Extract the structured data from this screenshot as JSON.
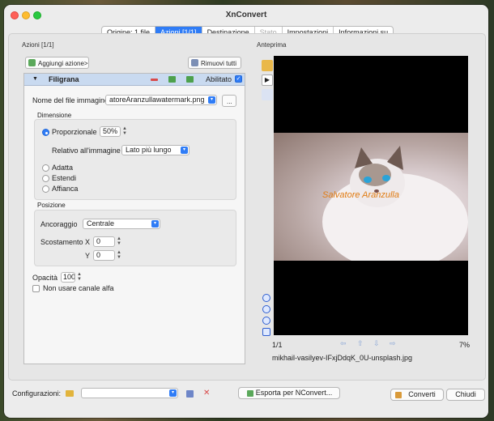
{
  "window": {
    "title": "XnConvert"
  },
  "tabs": [
    {
      "label": "Origine: 1 file",
      "state": "normal"
    },
    {
      "label": "Azioni [1/1]",
      "state": "active"
    },
    {
      "label": "Destinazione",
      "state": "normal"
    },
    {
      "label": "Stato",
      "state": "disabled"
    },
    {
      "label": "Impostazioni",
      "state": "normal"
    },
    {
      "label": "Informazioni su",
      "state": "normal"
    }
  ],
  "actions": {
    "header": "Azioni [1/1]",
    "add_button": "Aggiungi azione>",
    "remove_all_button": "Rimuovi tutti",
    "item": {
      "name": "Filigrana",
      "enabled_label": "Abilitato",
      "enabled": true,
      "file_label": "Nome del file immagine",
      "file_value": "atoreAranzullawatermark.png",
      "browse_label": "...",
      "dimension": {
        "title": "Dimensione",
        "proportional_label": "Proporzionale",
        "proportional_value": "50%",
        "relative_label": "Relativo all'immagine",
        "relative_value": "Lato più lungo",
        "fit_label": "Adatta",
        "stretch_label": "Estendi",
        "tile_label": "Affianca"
      },
      "position": {
        "title": "Posizione",
        "anchor_label": "Ancoraggio",
        "anchor_value": "Centrale",
        "offset_label": "Scostamento",
        "x_label": "X",
        "x_value": "0",
        "y_label": "Y",
        "y_value": "0"
      },
      "opacity_label": "Opacità",
      "opacity_value": "100",
      "no_alpha_label": "Non usare canale alfa",
      "no_alpha_checked": false
    }
  },
  "preview": {
    "header": "Anteprima",
    "watermark_text": "Salvatore Aranzulla",
    "counter": "1/1",
    "zoom": "7%",
    "filename": "mikhail-vasilyev-IFxjDdqK_0U-unsplash.jpg"
  },
  "bottom": {
    "config_label": "Configurazioni:",
    "config_value": "",
    "export_button": "Esporta per NConvert...",
    "convert_button": "Converti",
    "close_button": "Chiudi"
  },
  "colors": {
    "accent": "#2f7cf6",
    "selected_row": "#c9daf0",
    "watermark": "#e07b12"
  },
  "icons": [
    "add-action-icon",
    "remove-all-icon",
    "disclosure-triangle-icon",
    "remove-action-icon",
    "move-up-icon",
    "move-down-icon",
    "checkmark-icon",
    "zoom-in-icon",
    "zoom-out-icon",
    "zoom-fit-icon",
    "fullscreen-icon",
    "first-icon",
    "prev-icon",
    "next-icon",
    "last-icon",
    "folder-icon",
    "save-icon",
    "delete-icon",
    "export-icon",
    "convert-icon"
  ]
}
